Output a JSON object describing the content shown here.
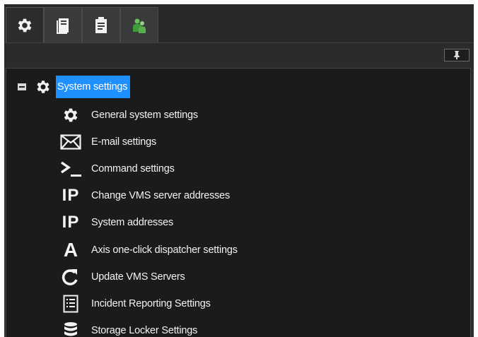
{
  "tabs": [
    {
      "icon": "gear-icon",
      "active": true
    },
    {
      "icon": "server-icon",
      "active": false
    },
    {
      "icon": "clipboard-icon",
      "active": false
    },
    {
      "icon": "users-icon",
      "active": false
    }
  ],
  "toolbar": {
    "pin_icon": "pin-icon"
  },
  "tree": {
    "root": {
      "label": "System settings",
      "icon": "gear-icon",
      "expanded": true,
      "selected": true
    },
    "items": [
      {
        "label": "General system settings",
        "icon": "gear-icon"
      },
      {
        "label": "E-mail settings",
        "icon": "mail-icon"
      },
      {
        "label": "Command settings",
        "icon": "terminal-icon",
        "glyph": ">_"
      },
      {
        "label": "Change VMS server addresses",
        "icon": "ip-icon",
        "glyph": "IP"
      },
      {
        "label": "System addresses",
        "icon": "ip-icon",
        "glyph": "IP"
      },
      {
        "label": "Axis one-click dispatcher settings",
        "icon": "axis-icon",
        "glyph": "A"
      },
      {
        "label": "Update VMS Servers",
        "icon": "refresh-icon"
      },
      {
        "label": "Incident Reporting Settings",
        "icon": "list-icon"
      },
      {
        "label": "Storage Locker Settings",
        "icon": "database-icon"
      }
    ]
  },
  "colors": {
    "selection": "#1e90ff",
    "tree_background": "#1b1b1b",
    "chrome_background": "#2e2e2e",
    "users_icon": "#4caf50"
  }
}
